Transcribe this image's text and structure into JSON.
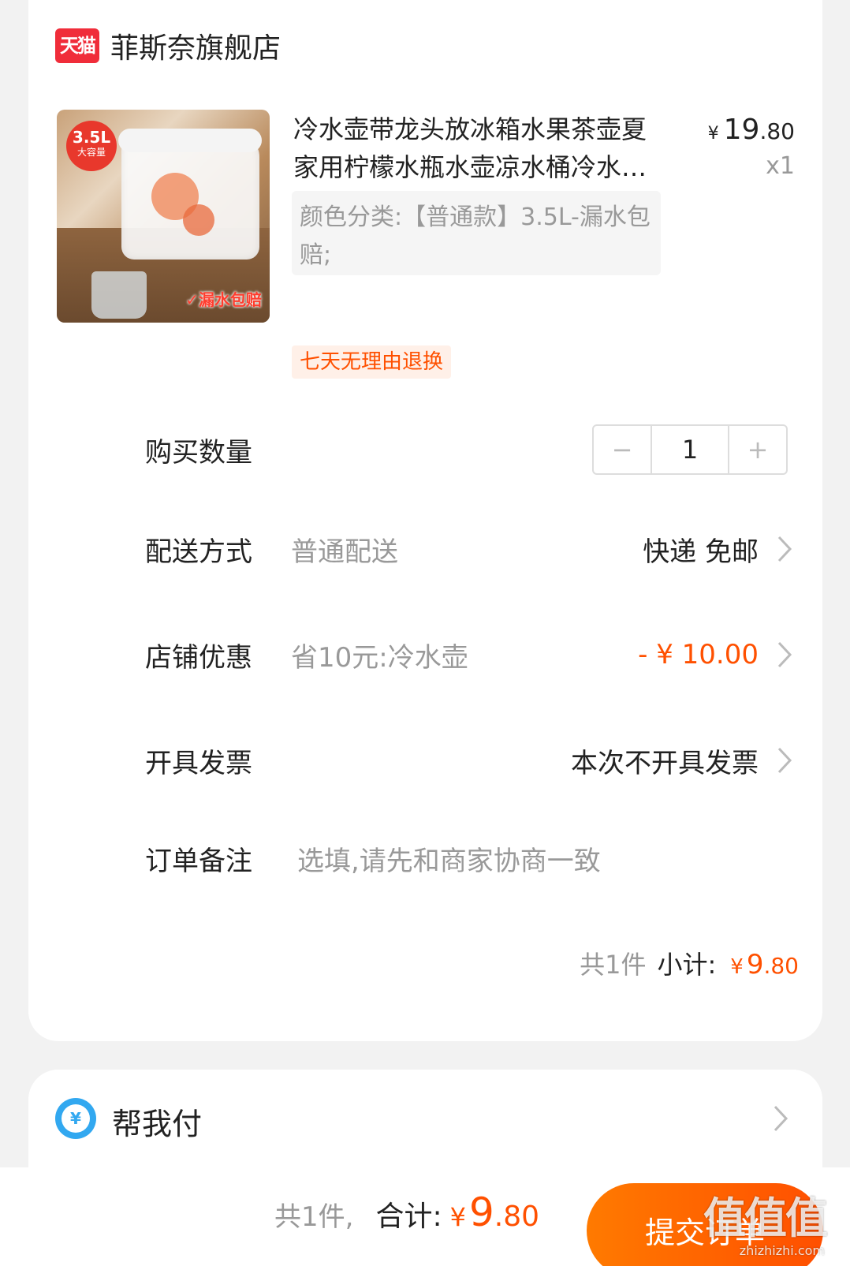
{
  "shop": {
    "logo_text": "天猫",
    "name": "菲斯奈旗舰店"
  },
  "product": {
    "image_badge_size": "3.5L",
    "image_badge_sub": "大容量",
    "image_leak_text": "✓漏水包赔",
    "title": "冷水壶带龙头放冰箱水果茶壶夏家用柠檬水瓶水壶凉水桶冷水桶大容量",
    "price_symbol": "¥",
    "price_int": "19",
    "price_dec": ".80",
    "quantity_label": "x1",
    "sku": "颜色分类:【普通款】3.5L-漏水包赔;",
    "return_tag": "七天无理由退换"
  },
  "rows": {
    "quantity": {
      "label": "购买数量",
      "value": "1",
      "minus": "−",
      "plus": "+"
    },
    "delivery": {
      "label": "配送方式",
      "sub": "普通配送",
      "value": "快递 免邮"
    },
    "discount": {
      "label": "店铺优惠",
      "sub": "省10元:冷水壶",
      "value": "- ¥ 10.00"
    },
    "invoice": {
      "label": "开具发票",
      "value": "本次不开具发票"
    },
    "note": {
      "label": "订单备注",
      "placeholder": "选填,请先和商家协商一致"
    }
  },
  "subtotal": {
    "count": "共1件",
    "label": "小计:",
    "symbol": "¥",
    "int": "9",
    "dec": ".80"
  },
  "pay_for_me": {
    "icon": "¥",
    "label": "帮我付"
  },
  "bottom": {
    "count": "共1件,",
    "label": "合计:",
    "symbol": "¥",
    "int": "9",
    "dec": ".80",
    "submit": "提交订单"
  },
  "watermark": {
    "text": "值值值",
    "url": "zhizhizhi.com"
  },
  "colors": {
    "accent": "#ff5000",
    "tmall_red": "#f02d3a",
    "pay_blue": "#32a8f0"
  }
}
